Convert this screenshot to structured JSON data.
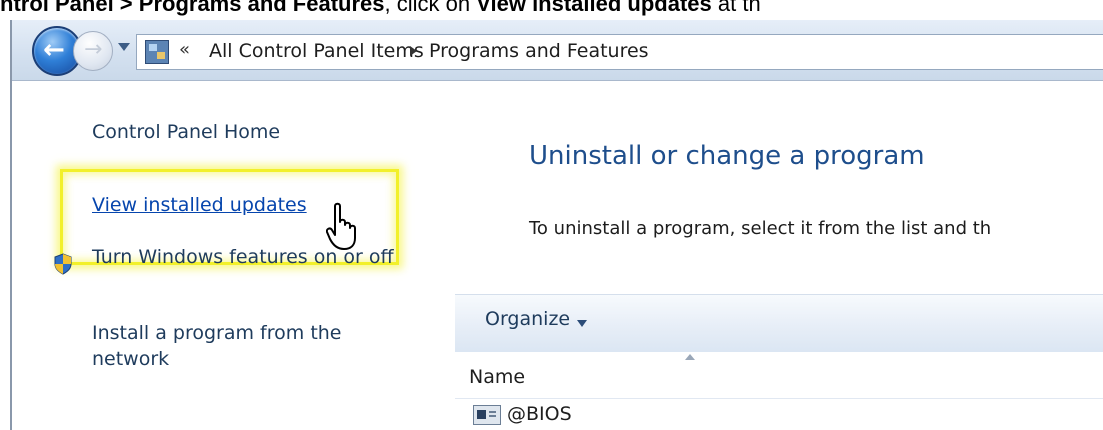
{
  "caption": {
    "part1": "ntrol Panel",
    "sep": " > ",
    "part2": "Programs and Features",
    "part3": ", click on ",
    "part4": "View installed updates",
    "part5": " at th"
  },
  "address_bar": {
    "chevrons": "«",
    "breadcrumb_1": "All Control Panel Items",
    "breadcrumb_2": "Programs and Features"
  },
  "left_pane": {
    "home": "Control Panel Home",
    "view_updates": "View installed updates",
    "windows_features": "Turn Windows features on or off",
    "install_network": "Install a program from the network"
  },
  "content": {
    "title": "Uninstall or change a program",
    "description": "To uninstall a program, select it from the list and th"
  },
  "toolbar": {
    "organize": "Organize"
  },
  "list": {
    "columns": [
      "Name"
    ],
    "rows": [
      "@BIOS"
    ]
  },
  "colors": {
    "highlight": "#f2f02a",
    "link": "#0645ad",
    "title": "#1e4e8c"
  },
  "icons": [
    "back-arrow-icon",
    "forward-arrow-icon",
    "control-panel-icon",
    "shield-icon",
    "hand-cursor-icon",
    "program-icon"
  ]
}
